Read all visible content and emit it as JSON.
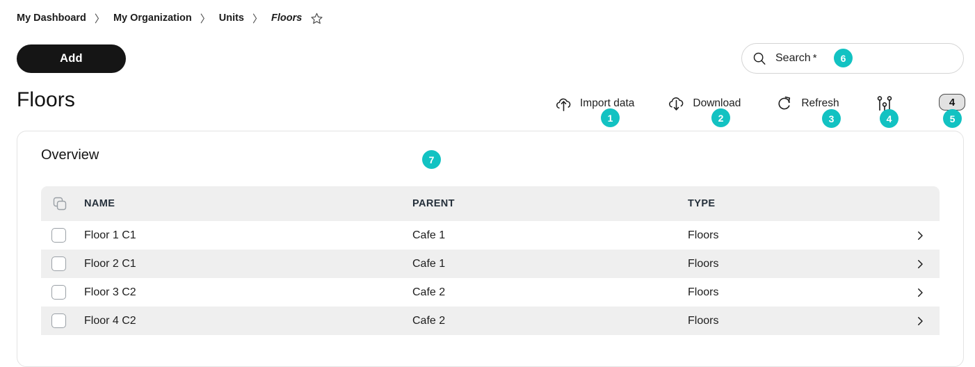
{
  "breadcrumb": {
    "separator": "〉",
    "items": [
      {
        "label": "My Dashboard",
        "current": false
      },
      {
        "label": "My Organization",
        "current": false
      },
      {
        "label": "Units",
        "current": false
      },
      {
        "label": "Floors",
        "current": true
      }
    ],
    "favorite_icon": "star-outline-icon"
  },
  "add_button": {
    "label": "Add"
  },
  "search": {
    "label": "Search",
    "required_mark": "*",
    "placeholder": "Search",
    "value": "",
    "icon": "search-icon",
    "badge": "6"
  },
  "page_title": "Floors",
  "toolbar": {
    "items": [
      {
        "label": "Import data",
        "icon": "cloud-upload-icon",
        "badge": "1"
      },
      {
        "label": "Download",
        "icon": "cloud-download-icon",
        "badge": "2"
      },
      {
        "label": "Refresh",
        "icon": "refresh-icon",
        "badge": "3"
      },
      {
        "label": "",
        "icon": "sliders-filter-icon",
        "badge": "4"
      }
    ],
    "count_pill": {
      "value": "4",
      "badge": "5"
    }
  },
  "card": {
    "overview_title": "Overview",
    "overview_badge": "7"
  },
  "table": {
    "select_all_icon": "copy-squares-icon",
    "columns": [
      "NAME",
      "PARENT",
      "TYPE"
    ],
    "row_arrow_icon": "chevron-right-icon",
    "rows": [
      {
        "name": "Floor 1 C1",
        "parent": "Cafe 1",
        "type": "Floors",
        "checked": false
      },
      {
        "name": "Floor 2 C1",
        "parent": "Cafe 1",
        "type": "Floors",
        "checked": false
      },
      {
        "name": "Floor 3 C2",
        "parent": "Cafe 2",
        "type": "Floors",
        "checked": false
      },
      {
        "name": "Floor 4 C2",
        "parent": "Cafe 2",
        "type": "Floors",
        "checked": false
      }
    ]
  },
  "colors": {
    "accent_badge": "#12c2c2",
    "button_dark": "#151515",
    "header_row": "#efefef",
    "stripe_row": "#efefef"
  }
}
